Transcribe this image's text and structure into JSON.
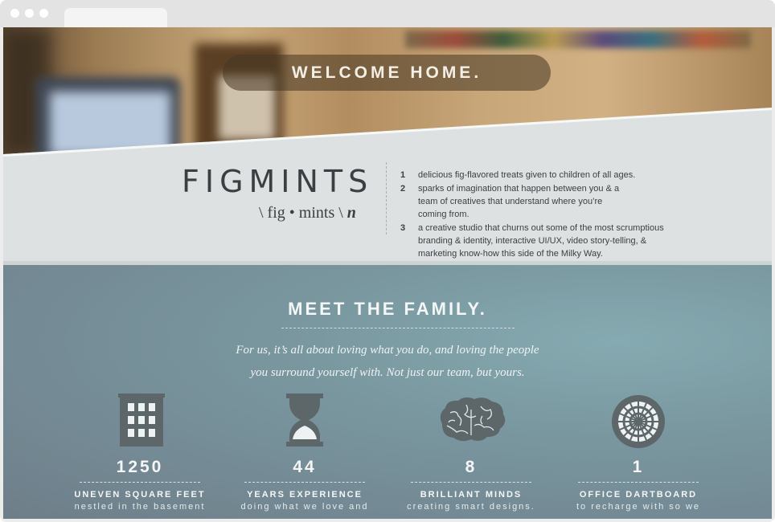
{
  "hero": {
    "welcome": "WELCOME HOME."
  },
  "brand": {
    "word": "FIGMINTS",
    "pronunciation": "\\ fig • mints \\",
    "pos": "n"
  },
  "definitions": [
    {
      "num": "1",
      "text": "delicious fig-flavored treats given to children of all ages."
    },
    {
      "num": "2",
      "text": "sparks of imagination that happen between you & a team of creatives that understand where you’re coming from."
    },
    {
      "num": "3",
      "text": "a creative studio that churns out some of the most scrumptious branding & identity, interactive UI/UX, video story-telling, & marketing know-how this side of the Milky Way."
    }
  ],
  "family": {
    "title": "MEET THE FAMILY.",
    "subtitle_line1": "For us, it’s all about loving what you do, and loving the people",
    "subtitle_line2": "you surround yourself with.  Not just our team, but yours."
  },
  "stats": [
    {
      "icon": "building-icon",
      "value": "1250",
      "label": "UNEVEN SQUARE FEET",
      "sub": "nestled in the basement"
    },
    {
      "icon": "hourglass-icon",
      "value": "44",
      "label": "YEARS EXPERIENCE",
      "sub": "doing what we love and"
    },
    {
      "icon": "brain-icon",
      "value": "8",
      "label": "BRILLIANT MINDS",
      "sub": "creating smart designs."
    },
    {
      "icon": "dartboard-icon",
      "value": "1",
      "label": "OFFICE DARTBOARD",
      "sub": "to recharge with so we"
    }
  ],
  "colors": {
    "icon_fill": "#5d6668",
    "text_light": "#f4f6f7",
    "text_dark": "#3c3f42"
  }
}
